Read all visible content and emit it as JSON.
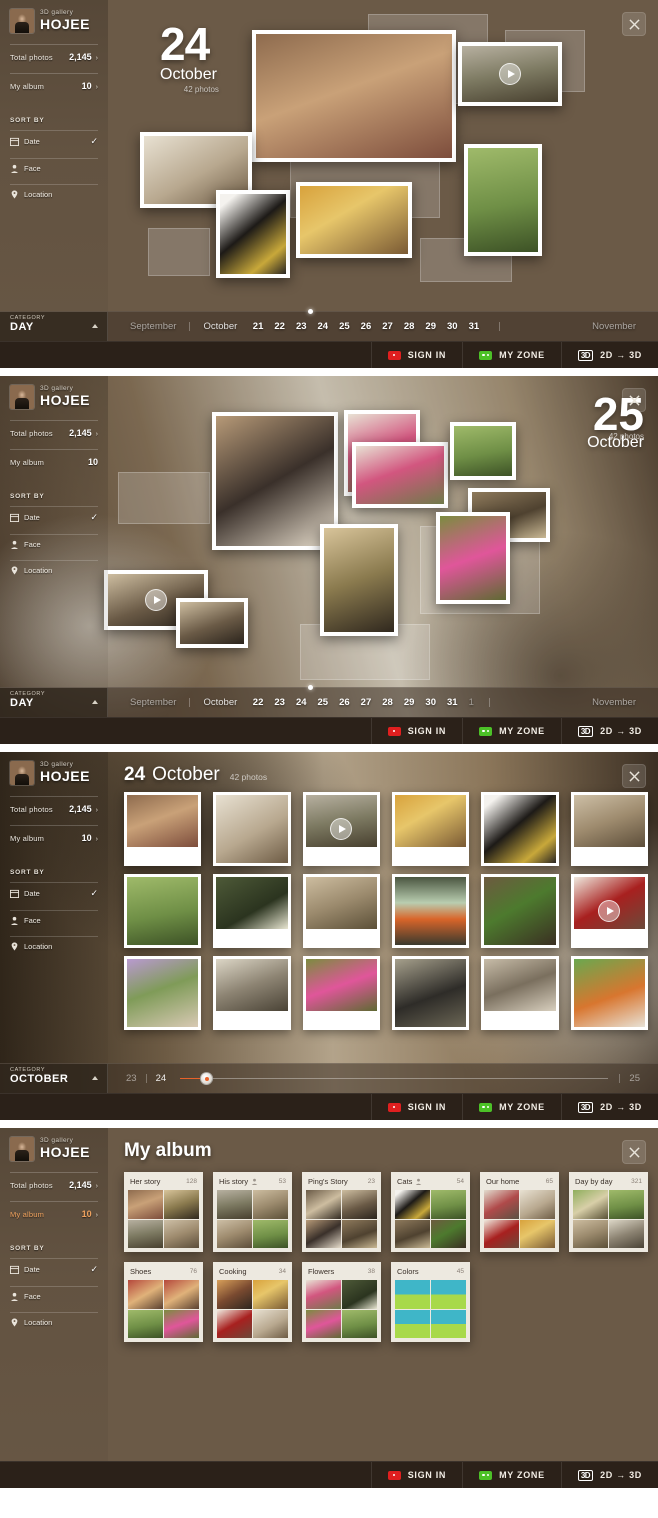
{
  "brand": {
    "sub": "3D gallery",
    "name": "HOJEE"
  },
  "sidebar": {
    "stats": [
      {
        "label": "Total photos",
        "value": "2,145",
        "arrow": "›"
      },
      {
        "label": "My album",
        "value": "10",
        "arrow": "›"
      }
    ],
    "sort_title": "SORT BY",
    "sort_items": [
      {
        "label": "Date",
        "icon": "calendar-icon",
        "checked": "✓"
      },
      {
        "label": "Face",
        "icon": "person-icon",
        "checked": ""
      },
      {
        "label": "Location",
        "icon": "location-pin-icon",
        "checked": ""
      }
    ]
  },
  "bottom_bar": {
    "sign_in": "SIGN IN",
    "my_zone": "MY ZONE",
    "badge": "3D",
    "mode": "2D → 3D"
  },
  "panel1": {
    "date": {
      "day": "24",
      "month": "October",
      "count": "42 photos"
    },
    "timeline": {
      "category_key": "CATEGORY",
      "category_value": "DAY",
      "month_prev": "September",
      "month_cur": "October",
      "month_next": "November",
      "days": [
        "21",
        "22",
        "23",
        "24",
        "25",
        "26",
        "27",
        "28",
        "29",
        "30",
        "31"
      ],
      "selected": "24"
    }
  },
  "panel2": {
    "date": {
      "day": "25",
      "month": "October",
      "count": "42 photos"
    },
    "timeline": {
      "category_key": "CATEGORY",
      "category_value": "DAY",
      "month_prev": "September",
      "month_cur": "October",
      "month_next": "November",
      "days": [
        "22",
        "23",
        "24",
        "25",
        "26",
        "27",
        "28",
        "29",
        "30",
        "31",
        "1"
      ],
      "selected": "25"
    }
  },
  "panel3": {
    "header": {
      "day": "24",
      "month": "October",
      "count": "42 photos"
    },
    "timeline": {
      "category_key": "CATEGORY",
      "category_value": "OCTOBER",
      "left_label": "23",
      "current_label": "24",
      "right_label": "25"
    },
    "photos": [
      {
        "alt": "girl-muddy-hands",
        "tex": "t-girl"
      },
      {
        "alt": "living-room",
        "tex": "t-room",
        "tall": true
      },
      {
        "alt": "two-kids-video",
        "tex": "t-kids",
        "play": true
      },
      {
        "alt": "breakfast-tray",
        "tex": "t-food"
      },
      {
        "alt": "tuxedo-cat",
        "tex": "t-cat",
        "tall": true
      },
      {
        "alt": "kids-on-deck",
        "tex": "t-play"
      },
      {
        "alt": "girl-with-basket",
        "tex": "t-grass",
        "tall": true
      },
      {
        "alt": "daisy-flower",
        "tex": "t-daisy"
      },
      {
        "alt": "two-children-field",
        "tex": "t-field"
      },
      {
        "alt": "vintage-caravan",
        "tex": "t-van",
        "tall": true
      },
      {
        "alt": "tree-bark-leaves",
        "tex": "t-bark",
        "tall": true
      },
      {
        "alt": "coffee-cups-video",
        "tex": "t-cup",
        "play": true
      },
      {
        "alt": "gnome-on-bench",
        "tex": "t-bench",
        "tall": true
      },
      {
        "alt": "roadside-shop",
        "tex": "t-shop"
      },
      {
        "alt": "girl-pink-dress",
        "tex": "t-pink"
      },
      {
        "alt": "boy-with-scarf",
        "tex": "t-scarf",
        "tall": true
      },
      {
        "alt": "street-ice-cream",
        "tex": "t-street"
      },
      {
        "alt": "melting-ice-cream",
        "tex": "t-ice",
        "tall": true
      }
    ]
  },
  "panel4": {
    "title": "My album",
    "albums": [
      {
        "name": "Her story",
        "count": "128",
        "face": false,
        "tex": [
          "t-girl",
          "t-girl2",
          "t-kids",
          "t-play"
        ]
      },
      {
        "name": "His story",
        "count": "53",
        "face": true,
        "tex": [
          "t-kids",
          "t-field",
          "t-play",
          "t-grass"
        ]
      },
      {
        "name": "Ping's Story",
        "count": "23",
        "face": false,
        "tex": [
          "t-ping",
          "t-pug",
          "t-dog",
          "t-stump"
        ]
      },
      {
        "name": "Cats",
        "count": "54",
        "face": true,
        "tex": [
          "t-cat",
          "t-grass",
          "t-stump",
          "t-bark"
        ]
      },
      {
        "name": "Our home",
        "count": "65",
        "face": false,
        "tex": [
          "t-home",
          "t-room",
          "t-cup",
          "t-food"
        ]
      },
      {
        "name": "Day by day",
        "count": "321",
        "face": false,
        "tex": [
          "t-day",
          "t-grass",
          "t-field",
          "t-shop"
        ]
      },
      {
        "name": "Shoes",
        "count": "76",
        "face": false,
        "tex": [
          "t-shoe",
          "t-shoe",
          "t-grass",
          "t-pink"
        ]
      },
      {
        "name": "Cooking",
        "count": "34",
        "face": false,
        "tex": [
          "t-cook",
          "t-food",
          "t-cup",
          "t-room"
        ]
      },
      {
        "name": "Flowers",
        "count": "38",
        "face": false,
        "tex": [
          "t-flower",
          "t-daisy",
          "t-pink",
          "t-grass"
        ]
      },
      {
        "name": "Colors",
        "count": "45",
        "face": false,
        "tex": [
          "t-color",
          "t-color",
          "t-color",
          "t-color"
        ]
      }
    ]
  },
  "close_label": "✕"
}
